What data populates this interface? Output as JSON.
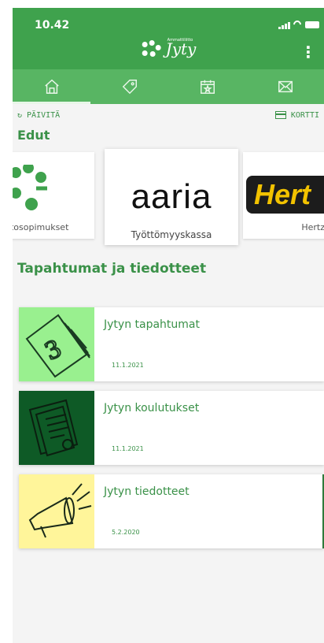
{
  "status_bar": {
    "time": "10.42"
  },
  "header": {
    "logo_text": "Jyty",
    "logo_small": "Ammattiliitto",
    "menu_icon": "kebab-menu-icon"
  },
  "tabs": [
    {
      "icon": "home-icon",
      "symbol": "⌂"
    },
    {
      "icon": "tag-icon",
      "symbol": "🏷"
    },
    {
      "icon": "calendar-icon",
      "symbol": "📅"
    },
    {
      "icon": "mail-icon",
      "symbol": "✉"
    }
  ],
  "toolbar": {
    "refresh_label": "PÄIVITÄ",
    "card_label": "KORTTI"
  },
  "benefits": {
    "title": "Edut",
    "cards": [
      {
        "caption": "htosopimukset"
      },
      {
        "logo": "aaria",
        "caption": "Työttömyyskassa"
      },
      {
        "logo": "Hert",
        "caption": "Hertz"
      }
    ]
  },
  "events": {
    "title": "Tapahtumat ja tiedotteet",
    "items": [
      {
        "title": "Jytyn tapahtumat",
        "date": "11.1.2021",
        "thumb_color": "#99f08f"
      },
      {
        "title": "Jytyn koulutukset",
        "date": "11.1.2021",
        "thumb_color": "#0e5a26"
      },
      {
        "title": "Jytyn tiedotteet",
        "date": "5.2.2020",
        "thumb_color": "#fff59a"
      }
    ]
  },
  "colors": {
    "primary": "#3fa24d",
    "tabbar": "#58b563",
    "text_accent": "#3a9148"
  }
}
